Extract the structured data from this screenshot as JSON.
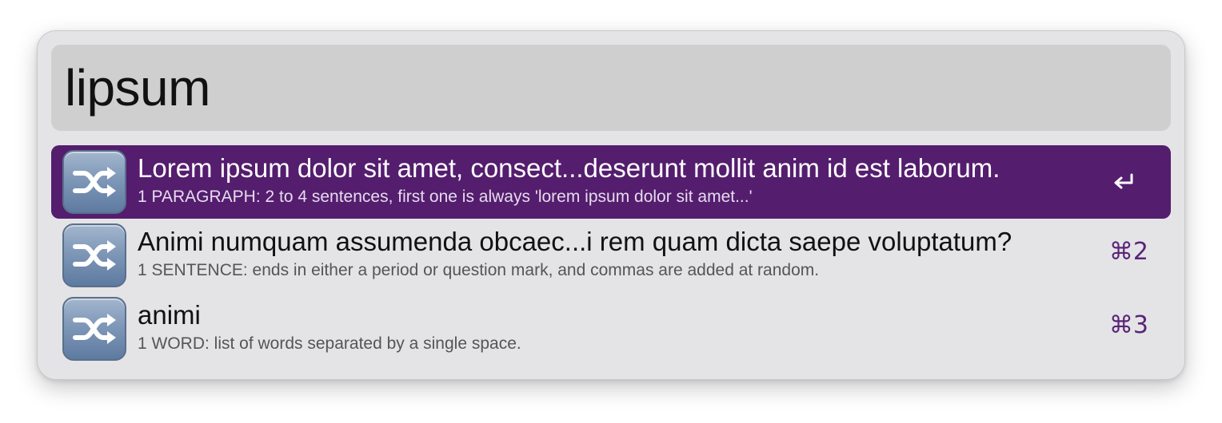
{
  "search": {
    "query": "lipsum"
  },
  "results": [
    {
      "title": "Lorem ipsum dolor sit amet, consect...deserunt mollit anim id est laborum.",
      "subtitle": "1 PARAGRAPH: 2 to 4 sentences, first one is always 'lorem ipsum dolor sit amet...'",
      "icon": "shuffle-icon",
      "action_icon": "return-icon",
      "selected": true
    },
    {
      "title": "Animi numquam assumenda obcaec...i rem quam dicta saepe voluptatum?",
      "subtitle": "1 SENTENCE: ends in either a period or question mark, and commas are added at random.",
      "icon": "shuffle-icon",
      "shortcut": "⌘2",
      "selected": false
    },
    {
      "title": "animi",
      "subtitle": "1 WORD: list of words separated by a single space.",
      "icon": "shuffle-icon",
      "shortcut": "⌘3",
      "selected": false
    }
  ],
  "colors": {
    "selection": "#541d6e",
    "shortcut": "#5a2478",
    "window": "#e4e4e6",
    "search_field": "#cfcfd0"
  }
}
